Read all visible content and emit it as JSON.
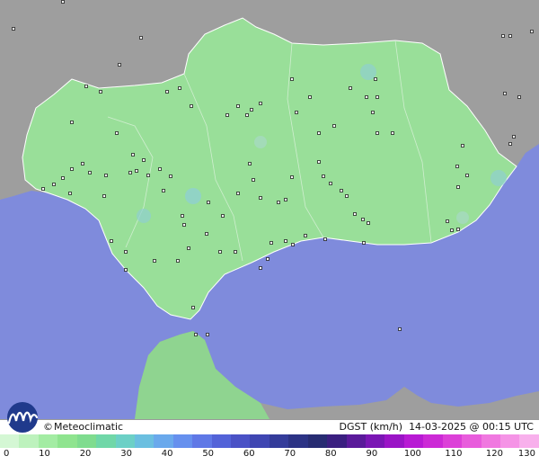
{
  "credit": {
    "symbol": "©",
    "text": "Meteoclimatic"
  },
  "variable": "DGST (km/h)",
  "timestamp": "14-03-2025 @ 00:15 UTC",
  "colors": {
    "sea": "#7f8bdc",
    "land_outside": "#9e9e9e",
    "region": "#99df99",
    "logo": "#203a8c",
    "station_dot": "#ffffff"
  },
  "legend": {
    "ticks": [
      "0",
      "10",
      "20",
      "30",
      "40",
      "50",
      "60",
      "70",
      "80",
      "90",
      "100",
      "110",
      "120",
      "130"
    ],
    "colors": [
      "#d4f7d4",
      "#bdf2bd",
      "#a3eca3",
      "#8fe48f",
      "#7fdc8f",
      "#70d7a8",
      "#6cd0c6",
      "#6bbfe0",
      "#6aa9ec",
      "#6690ee",
      "#5f78e6",
      "#5363d8",
      "#4a52c6",
      "#3f46b2",
      "#343c9a",
      "#2c3385",
      "#272c72",
      "#3a1f80",
      "#5a1a9a",
      "#7a16b4",
      "#9a14c6",
      "#b81ad4",
      "#cc2ad6",
      "#dc40d8",
      "#e85cdc",
      "#f078e0",
      "#f594e6",
      "#f8b0ec"
    ]
  }
}
